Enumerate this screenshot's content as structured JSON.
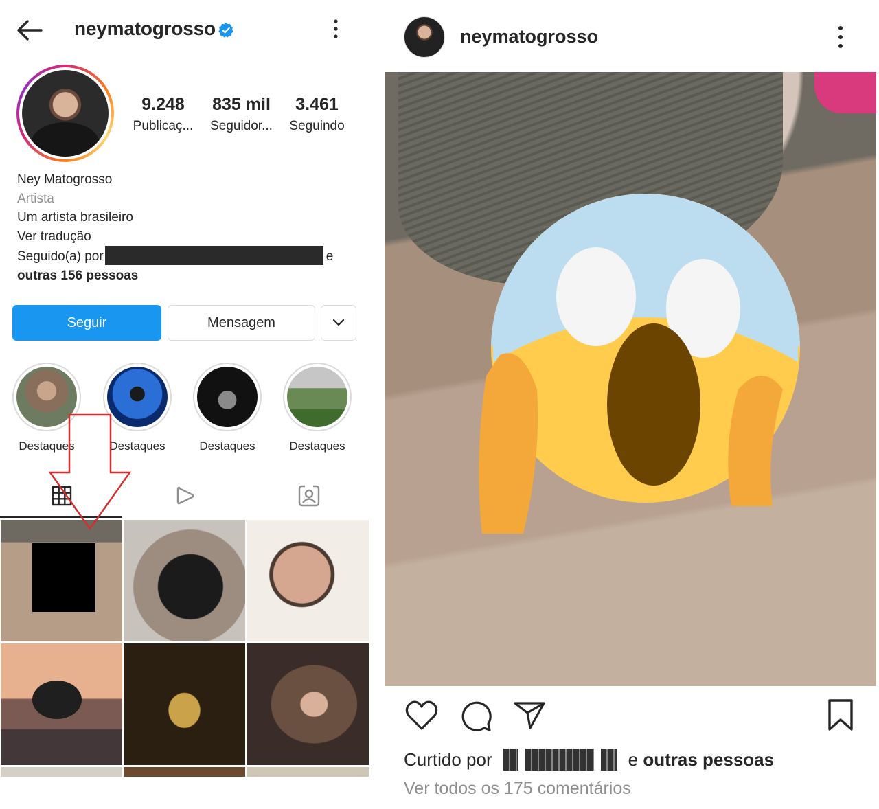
{
  "profile": {
    "username": "neymatogrosso",
    "stats": [
      {
        "value": "9.248",
        "label": "Publicaç..."
      },
      {
        "value": "835 mil",
        "label": "Seguidor..."
      },
      {
        "value": "3.461",
        "label": "Seguindo"
      }
    ],
    "bio": {
      "name": "Ney Matogrosso",
      "category": "Artista",
      "description": "Um artista brasileiro",
      "translate": "Ver tradução",
      "followed_by_prefix": "Seguido(a) por",
      "followed_by_suffix": "e",
      "others": "outras 156 pessoas"
    },
    "buttons": {
      "follow": "Seguir",
      "message": "Mensagem"
    },
    "highlights": [
      {
        "label": "Destaques"
      },
      {
        "label": "Destaques"
      },
      {
        "label": "Destaques"
      },
      {
        "label": "Destaques"
      }
    ]
  },
  "post": {
    "username": "neymatogrosso",
    "liked_by_prefix": "Curtido por",
    "liked_by_suffix_plain": "e",
    "liked_by_suffix_bold": "outras pessoas",
    "comments_link": "Ver todos os 175 comentários"
  },
  "colors": {
    "accent_blue": "#1896f0",
    "annotation_red": "#d32f2f",
    "muted_text": "#8e8e8e"
  },
  "icons": {
    "back": "arrow-left-icon",
    "verified": "verified-badge-icon",
    "more": "kebab-menu-icon",
    "grid": "grid-icon",
    "reels": "play-icon",
    "tagged": "tagged-person-icon",
    "like": "heart-icon",
    "comment": "comment-bubble-icon",
    "share": "paper-plane-icon",
    "save": "bookmark-icon"
  }
}
